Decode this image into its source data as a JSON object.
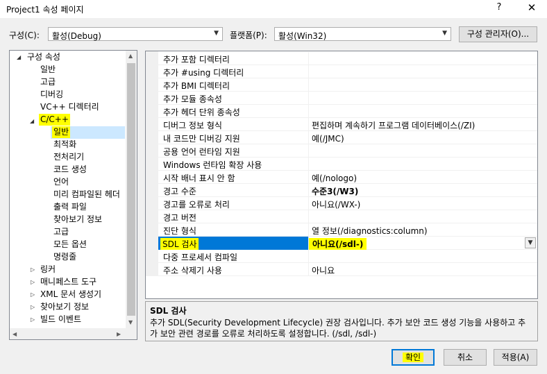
{
  "window": {
    "title": "Project1 속성 페이지",
    "help": "?",
    "close": "✕"
  },
  "toolbar": {
    "config_label": "구성(C):",
    "config_value": "활성(Debug)",
    "platform_label": "플랫폼(P):",
    "platform_value": "활성(Win32)",
    "config_manager": "구성 관리자(O)..."
  },
  "tree": {
    "root": "구성 속성",
    "items": [
      "일반",
      "고급",
      "디버깅",
      "VC++ 디렉터리"
    ],
    "cpp": "C/C++",
    "cpp_children": [
      "일반",
      "최적화",
      "전처리기",
      "코드 생성",
      "언어",
      "미리 컴파일된 헤더",
      "출력 파일",
      "찾아보기 정보",
      "고급",
      "모든 옵션",
      "명령줄"
    ],
    "collapsed": [
      "링커",
      "매니페스트 도구",
      "XML 문서 생성기",
      "찾아보기 정보",
      "빌드 이벤트"
    ]
  },
  "grid": {
    "rows": [
      {
        "name": "추가 포함 디렉터리",
        "value": ""
      },
      {
        "name": "추가 #using 디렉터리",
        "value": ""
      },
      {
        "name": "추가 BMI 디렉터리",
        "value": ""
      },
      {
        "name": "추가 모듈 종속성",
        "value": ""
      },
      {
        "name": "추가 헤더 단위 종속성",
        "value": ""
      },
      {
        "name": "디버그 정보 형식",
        "value": "편집하며 계속하기 프로그램 데이터베이스(/ZI)"
      },
      {
        "name": "내 코드만 디버깅 지원",
        "value": "예(/JMC)"
      },
      {
        "name": "공용 언어 런타임 지원",
        "value": ""
      },
      {
        "name": "Windows 런타임 확장 사용",
        "value": ""
      },
      {
        "name": "시작 배너 표시 안 함",
        "value": "예(/nologo)"
      },
      {
        "name": "경고 수준",
        "value": "수준3(/W3)"
      },
      {
        "name": "경고를 오류로 처리",
        "value": "아니요(/WX-)"
      },
      {
        "name": "경고 버전",
        "value": ""
      },
      {
        "name": "진단 형식",
        "value": "열 정보(/diagnostics:column)"
      },
      {
        "name": "SDL 검사",
        "value": "아니요(/sdl-)"
      },
      {
        "name": "다중 프로세서 컴파일",
        "value": ""
      },
      {
        "name": "주소 삭제기 사용",
        "value": "아니요"
      }
    ]
  },
  "description": {
    "title": "SDL 검사",
    "text": "추가 SDL(Security Development Lifecycle) 권장 검사입니다. 추가 보안 코드 생성 기능을 사용하고 추가 보안 관련 경로를 오류로 처리하도록 설정합니다. (/sdl, /sdl-)"
  },
  "buttons": {
    "ok": "확인",
    "cancel": "취소",
    "apply": "적용(A)"
  },
  "colors": {
    "selection": "#0078d7",
    "highlight": "#ffff00",
    "tree_selection": "#cce8ff"
  }
}
